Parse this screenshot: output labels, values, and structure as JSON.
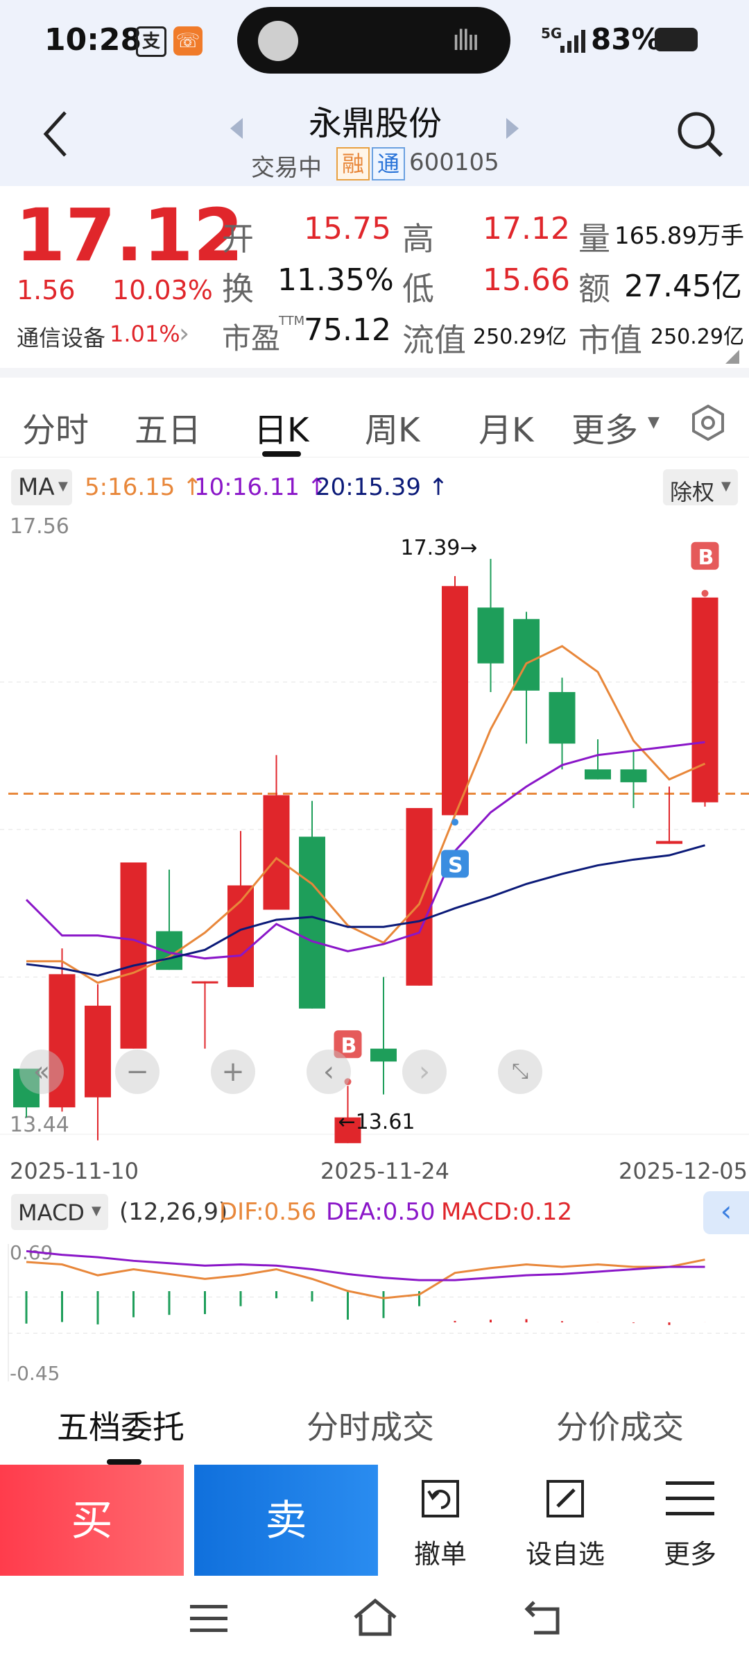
{
  "status": {
    "time": "10:28",
    "network": "5G",
    "battery": "83%"
  },
  "header": {
    "stock_name": "永鼎股份",
    "trade_status": "交易中",
    "tag_rong": "融",
    "tag_tong": "通",
    "code": "600105"
  },
  "quote": {
    "price": "17.12",
    "change": "1.56",
    "change_pct": "10.03%",
    "sector": "通信设备",
    "sector_pct": "1.01%",
    "open_label": "开",
    "open": "15.75",
    "high_label": "高",
    "high": "17.12",
    "volume_label": "量",
    "volume": "165.89万手",
    "turnover_label": "换",
    "turnover": "11.35%",
    "low_label": "低",
    "low": "15.66",
    "amount_label": "额",
    "amount": "27.45亿",
    "pe_label": "市盈",
    "pe_sup": "TTM",
    "pe": "75.12",
    "float_cap_label": "流值",
    "float_cap": "250.29亿",
    "mkt_cap_label": "市值",
    "mkt_cap": "250.29亿"
  },
  "tabs": [
    "分时",
    "五日",
    "日K",
    "周K",
    "月K",
    "更多"
  ],
  "active_tab": "日K",
  "ma_legend": {
    "label": "MA",
    "ma5": "5:16.15 ↑",
    "ma10": "10:16.11 ↑",
    "ma20": "20:15.39 ↑",
    "adjust": "除权"
  },
  "colors": {
    "up": "#e0262b",
    "down": "#1e9e5a",
    "ma5": "#e8873a",
    "ma10": "#8a16c8",
    "ma20": "#0b1a78",
    "buy_btn": "#ff4a5a",
    "sell_btn": "#1d7ce0"
  },
  "chart_data": {
    "type": "candlestick",
    "y_axis": {
      "top_label": "17.56",
      "bottom_label": "13.44",
      "min": 13.44,
      "max": 17.56
    },
    "x_labels": [
      "2025-11-10",
      "2025-11-24",
      "2025-12-05"
    ],
    "reference_price": 15.75,
    "candles": [
      {
        "o": 13.83,
        "h": 13.83,
        "l": 13.49,
        "c": 13.56
      },
      {
        "o": 13.56,
        "h": 14.67,
        "l": 13.53,
        "c": 14.49
      },
      {
        "o": 13.63,
        "h": 14.42,
        "l": 13.33,
        "c": 14.27
      },
      {
        "o": 13.97,
        "h": 15.27,
        "l": 13.97,
        "c": 15.27
      },
      {
        "o": 14.79,
        "h": 15.22,
        "l": 14.52,
        "c": 14.52
      },
      {
        "o": 14.44,
        "h": 14.44,
        "l": 13.97,
        "c": 14.44
      },
      {
        "o": 14.4,
        "h": 15.49,
        "l": 14.4,
        "c": 15.11
      },
      {
        "o": 14.94,
        "h": 16.02,
        "l": 14.94,
        "c": 15.74
      },
      {
        "o": 15.45,
        "h": 15.7,
        "l": 14.3,
        "c": 14.25
      },
      {
        "o": 13.31,
        "h": 13.71,
        "l": 13.61,
        "c": 13.49
      },
      {
        "o": 13.97,
        "h": 14.47,
        "l": 13.65,
        "c": 13.88
      },
      {
        "o": 14.41,
        "h": 15.62,
        "l": 14.41,
        "c": 15.65
      },
      {
        "o": 15.6,
        "h": 17.27,
        "l": 15.6,
        "c": 17.2
      },
      {
        "o": 17.05,
        "h": 17.39,
        "l": 16.46,
        "c": 16.66
      },
      {
        "o": 16.97,
        "h": 17.02,
        "l": 16.1,
        "c": 16.47
      },
      {
        "o": 16.46,
        "h": 16.56,
        "l": 15.92,
        "c": 16.1
      },
      {
        "o": 15.92,
        "h": 16.13,
        "l": 15.85,
        "c": 15.85
      },
      {
        "o": 15.92,
        "h": 16.05,
        "l": 15.65,
        "c": 15.83
      },
      {
        "o": 15.4,
        "h": 15.8,
        "l": 15.42,
        "c": 15.42
      },
      {
        "o": 15.69,
        "h": 17.12,
        "l": 15.66,
        "c": 17.12
      }
    ],
    "ma5": [
      14.58,
      14.58,
      14.43,
      14.5,
      14.61,
      14.78,
      15.0,
      15.3,
      15.12,
      14.83,
      14.71,
      14.98,
      15.6,
      16.2,
      16.66,
      16.78,
      16.6,
      16.12,
      15.85,
      15.96
    ],
    "ma10": [
      15.01,
      14.76,
      14.76,
      14.73,
      14.64,
      14.6,
      14.62,
      14.84,
      14.72,
      14.65,
      14.7,
      14.78,
      15.35,
      15.62,
      15.8,
      15.95,
      16.02,
      16.05,
      16.08,
      16.11
    ],
    "ma20": [
      14.56,
      14.53,
      14.48,
      14.55,
      14.6,
      14.66,
      14.8,
      14.87,
      14.89,
      14.82,
      14.82,
      14.86,
      14.95,
      15.03,
      15.12,
      15.19,
      15.25,
      15.29,
      15.32,
      15.39
    ],
    "annotations": {
      "high": "17.39→",
      "low": "←13.61",
      "signals": [
        {
          "label": "B",
          "index": 9
        },
        {
          "label": "S",
          "index": 12
        },
        {
          "label": "B",
          "index": 19
        }
      ]
    }
  },
  "macd": {
    "label": "MACD",
    "params": "(12,26,9)",
    "dif": "DIF:0.56",
    "dea": "DEA:0.50",
    "macd": "MACD:0.12",
    "top_label": "0.69",
    "bottom_label": "-0.45",
    "min": -0.45,
    "max": 0.69,
    "dif_values": [
      0.54,
      0.52,
      0.43,
      0.48,
      0.44,
      0.4,
      0.43,
      0.48,
      0.4,
      0.3,
      0.24,
      0.27,
      0.45,
      0.49,
      0.52,
      0.5,
      0.52,
      0.5,
      0.5,
      0.56
    ],
    "dea_values": [
      0.63,
      0.6,
      0.58,
      0.55,
      0.53,
      0.51,
      0.52,
      0.51,
      0.48,
      0.44,
      0.41,
      0.39,
      0.39,
      0.41,
      0.43,
      0.44,
      0.46,
      0.48,
      0.5,
      0.5
    ],
    "hist": [
      -0.41,
      -0.39,
      -0.42,
      -0.33,
      -0.3,
      -0.29,
      -0.19,
      -0.09,
      -0.13,
      -0.36,
      -0.34,
      -0.19,
      0.17,
      0.21,
      0.23,
      0.16,
      0.12,
      0.1,
      0.03,
      0.12
    ]
  },
  "bottom_tabs": [
    "五档委托",
    "分时成交",
    "分价成交"
  ],
  "actions": {
    "buy": "买",
    "sell": "卖",
    "cancel": "撤单",
    "watchlist": "设自选",
    "more": "更多"
  }
}
